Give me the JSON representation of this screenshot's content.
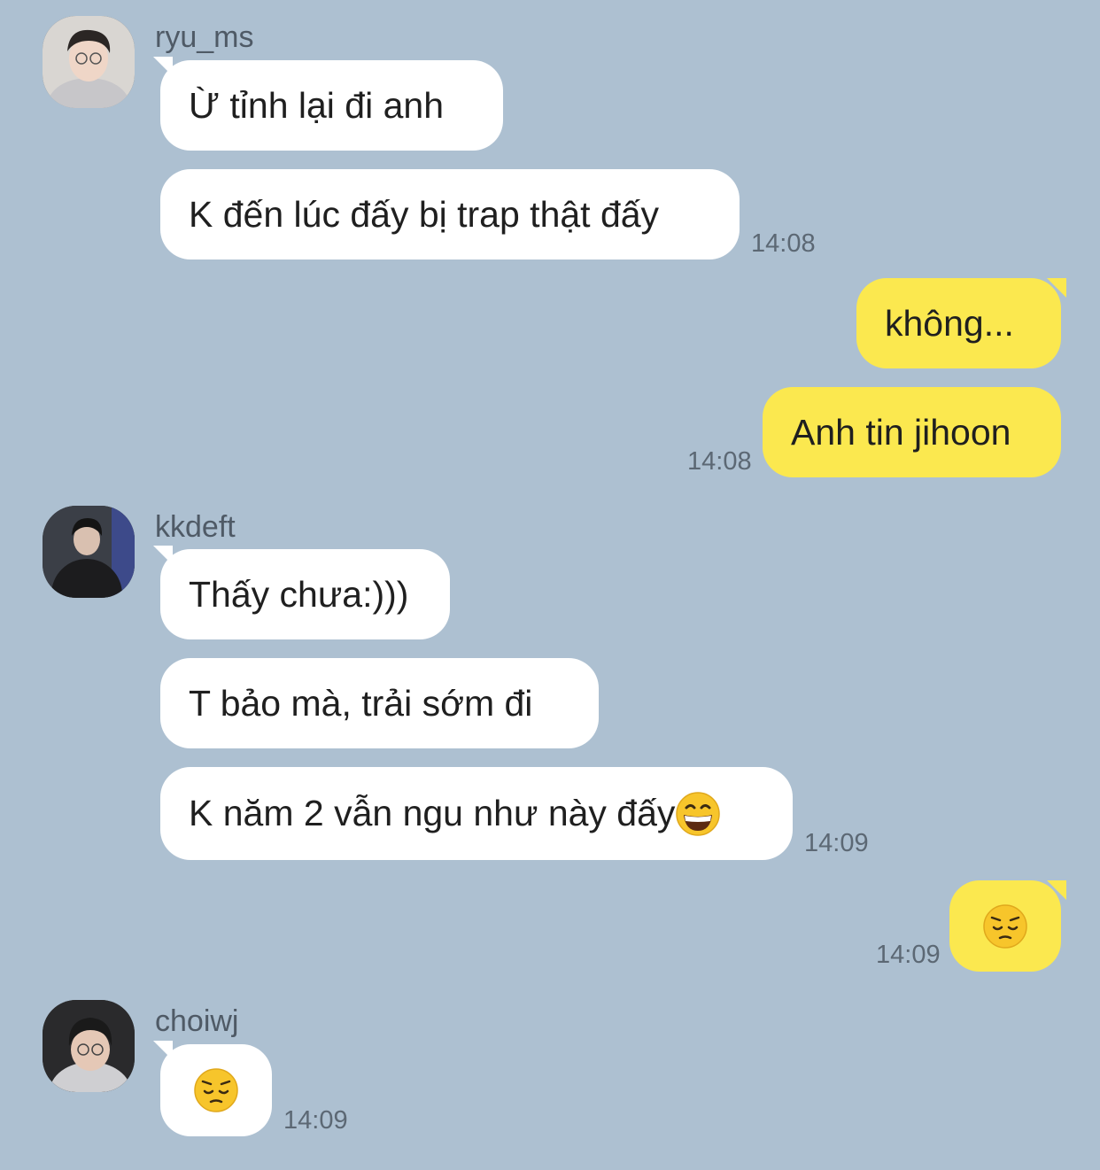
{
  "messages": [
    {
      "sender": "ryu_ms",
      "text": "Ừ tỉnh lại đi anh"
    },
    {
      "sender": "ryu_ms",
      "text": "K đến lúc đấy bị trap thật đấy",
      "time": "14:08"
    },
    {
      "sender": "me",
      "text": "không..."
    },
    {
      "sender": "me",
      "text": "Anh tin jihoon",
      "time": "14:08"
    },
    {
      "sender": "kkdeft",
      "text": "Thấy chưa:)))"
    },
    {
      "sender": "kkdeft",
      "text": "T bảo mà, trải sớm đi"
    },
    {
      "sender": "kkdeft",
      "text": "K năm 2 vẫn ngu như này đấy",
      "emoji": "grinning-face-emoji",
      "time": "14:09"
    },
    {
      "sender": "me",
      "emoji": "pensive-face-emoji",
      "time": "14:09"
    },
    {
      "sender": "choiwj",
      "emoji": "pensive-face-emoji",
      "time": "14:09"
    }
  ],
  "senders": {
    "ryu_ms": "ryu_ms",
    "kkdeft": "kkdeft",
    "choiwj": "choiwj"
  },
  "colors": {
    "background": "#adc0d1",
    "incoming_bubble": "#ffffff",
    "outgoing_bubble": "#fbe84f"
  }
}
